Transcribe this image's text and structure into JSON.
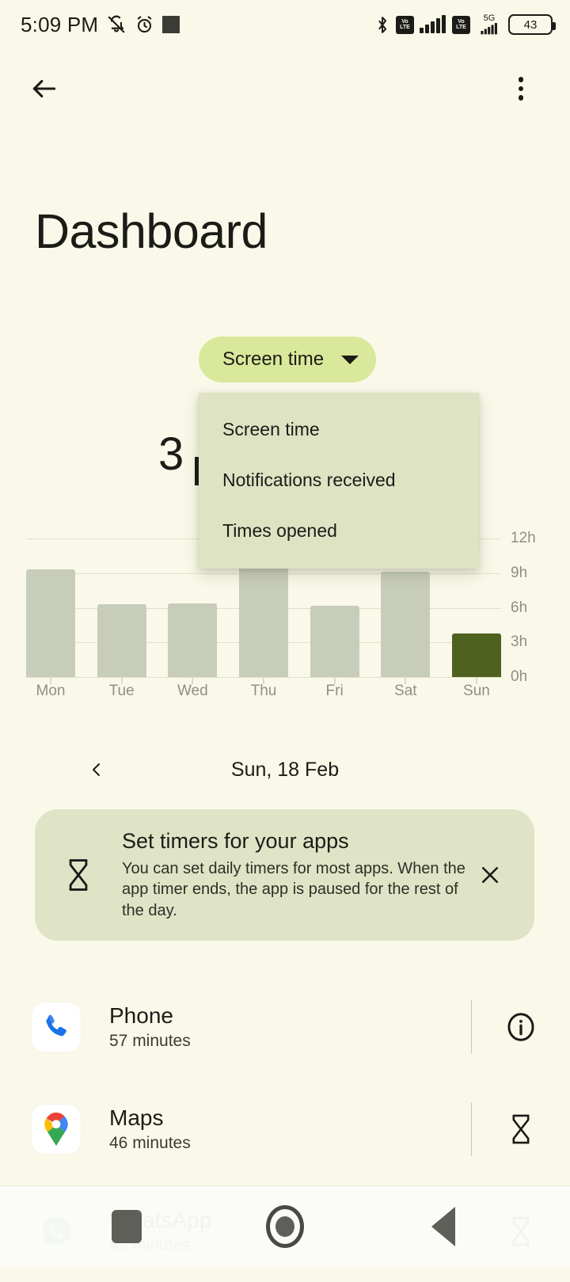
{
  "status_bar": {
    "time": "5:09 PM",
    "battery_level": "43",
    "network_5g": "5G",
    "volte_1": "VoLTE",
    "volte_2": "VoLTE",
    "icons": [
      "mute-bell-icon",
      "alarm-icon",
      "square-icon",
      "bluetooth-icon",
      "volte-icon",
      "signal-icon",
      "volte-icon",
      "5g-icon",
      "signal-icon",
      "battery-icon"
    ]
  },
  "app_bar": {
    "back_label": "Back",
    "overflow_label": "More options"
  },
  "header": {
    "title": "Dashboard"
  },
  "metric_selector": {
    "selected": "Screen time",
    "expanded": true,
    "options": [
      "Screen time",
      "Notifications received",
      "Times opened"
    ]
  },
  "summary": {
    "value": "3 h"
  },
  "chart_data": {
    "type": "bar",
    "title": "Screen time",
    "categories": [
      "Mon",
      "Tue",
      "Wed",
      "Thu",
      "Fri",
      "Sat",
      "Sun"
    ],
    "values": [
      9.3,
      6.3,
      6.4,
      10.2,
      6.2,
      9.1,
      3.8
    ],
    "value_labels": [
      "9 h 18 m",
      "6 h 18 m",
      "6 h 24 m",
      "10 h 12 m",
      "6 h 12 m",
      "9 h 6 m",
      "3 h 48 m"
    ],
    "ytick_labels": [
      "12h",
      "9h",
      "6h",
      "3h",
      "0h"
    ],
    "ytick_values": [
      12,
      9,
      6,
      3,
      0
    ],
    "ylim": [
      0,
      12
    ],
    "ylabel": "",
    "xlabel": "",
    "grid": true,
    "legend": "none",
    "highlight_index": 6,
    "bar_color": "#C8CDBA",
    "highlight_color": "#4F611F",
    "grid_color": "#E0DFCB",
    "tick_text_color": "#8F907F"
  },
  "date_nav": {
    "prev_label": "Previous day",
    "date": "Sun, 18 Feb"
  },
  "tip_card": {
    "icon": "hourglass-icon",
    "title": "Set timers for your apps",
    "description": "You can set daily timers for most apps. When the app timer ends, the app is paused for the rest of the day.",
    "close_label": "Dismiss"
  },
  "app_usage": {
    "rows": [
      {
        "name": "Phone",
        "time": "57 minutes",
        "icon": "phone-app-icon",
        "action": "info-icon"
      },
      {
        "name": "Maps",
        "time": "46 minutes",
        "icon": "maps-app-icon",
        "action": "hourglass-icon"
      },
      {
        "name": "WhatsApp",
        "time": "42 minutes",
        "icon": "whatsapp-app-icon",
        "action": "hourglass-icon"
      }
    ]
  },
  "nav_bar": {
    "recents_label": "Recents",
    "home_label": "Home",
    "back_label": "Back"
  },
  "colors": {
    "background": "#FAF9E9",
    "chip": "#D9E89B",
    "menu": "#DEE3C4",
    "card": "#DFE4C6",
    "accent": "#4F611F",
    "bar": "#C8CDBA",
    "text": "#1B1C17"
  }
}
